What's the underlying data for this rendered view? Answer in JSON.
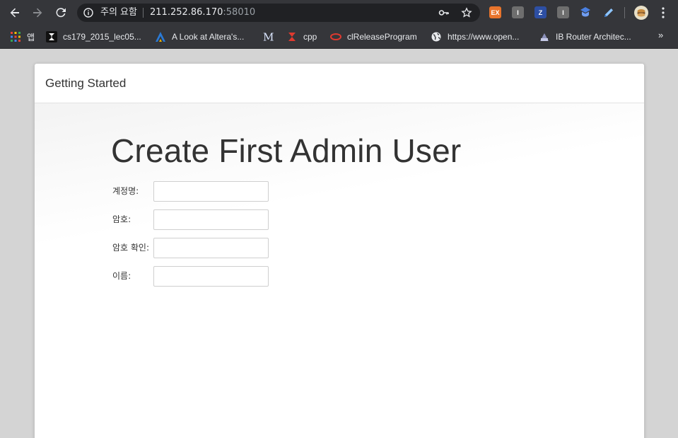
{
  "browser": {
    "security_warning": "주의 요함",
    "url_host": "211.252.86.170",
    "url_port": ":58010",
    "extensions": [
      {
        "name": "ex-extension",
        "label": "EX",
        "color": "#e8742c"
      },
      {
        "name": "i-extension-1",
        "label": "I",
        "color": "#6e6e6e"
      },
      {
        "name": "zotero-extension",
        "label": "Z",
        "color": "#2d4fa3"
      },
      {
        "name": "i-extension-2",
        "label": "I",
        "color": "#6e6e6e"
      }
    ]
  },
  "bookmarks": {
    "items": [
      {
        "label": "앱"
      },
      {
        "label": "cs179_2015_lec05..."
      },
      {
        "label": "A Look at Altera's..."
      },
      {
        "label": ""
      },
      {
        "label": "cpp"
      },
      {
        "label": "clReleaseProgram"
      },
      {
        "label": "https://www.open..."
      },
      {
        "label": "IB Router Architec..."
      }
    ],
    "more": "»"
  },
  "page": {
    "panel_title": "Getting Started",
    "heading": "Create First Admin User",
    "fields": [
      {
        "label": "계정명:",
        "value": ""
      },
      {
        "label": "암호:",
        "value": ""
      },
      {
        "label": "암호 확인:",
        "value": ""
      },
      {
        "label": "이름:",
        "value": ""
      }
    ]
  }
}
